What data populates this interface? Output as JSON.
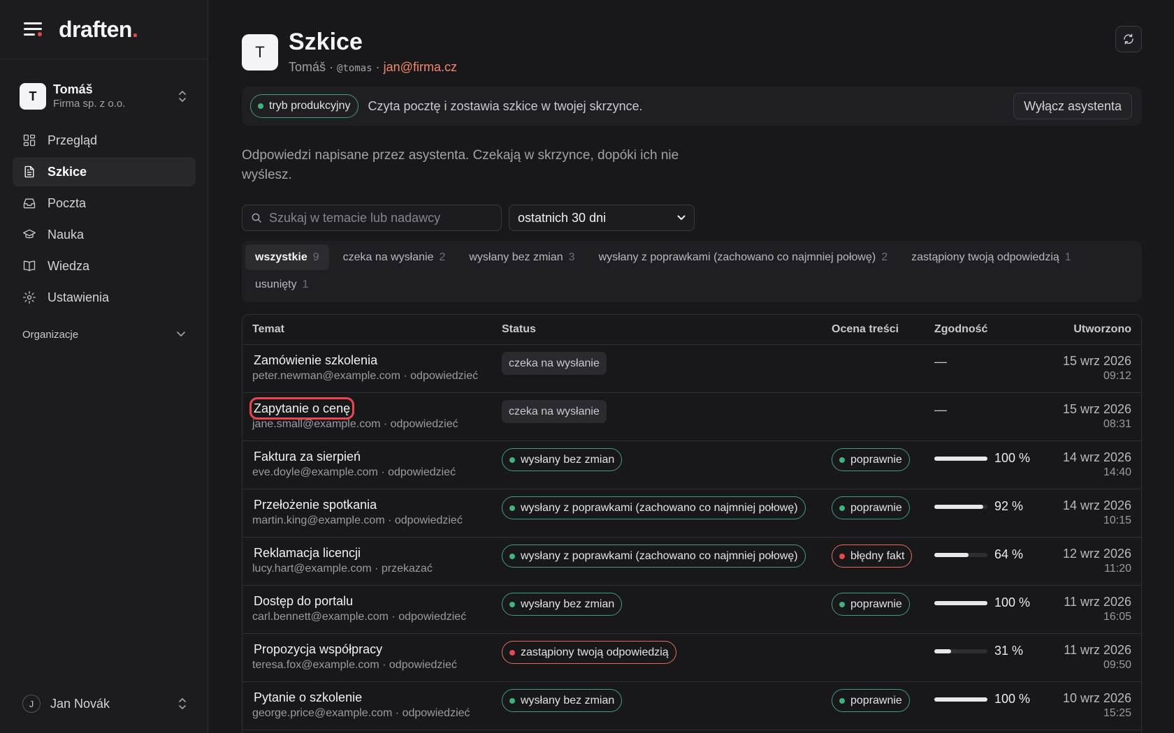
{
  "brand": {
    "name": "draften",
    "dot": "."
  },
  "account": {
    "initial": "T",
    "name": "Tomáš",
    "org": "Firma sp. z o.o."
  },
  "nav": [
    {
      "label": "Przegląd",
      "icon": "grid-icon",
      "active": false
    },
    {
      "label": "Szkice",
      "icon": "document-icon",
      "active": true
    },
    {
      "label": "Poczta",
      "icon": "inbox-icon",
      "active": false
    },
    {
      "label": "Nauka",
      "icon": "graduation-cap-icon",
      "active": false
    },
    {
      "label": "Wiedza",
      "icon": "book-icon",
      "active": false
    },
    {
      "label": "Ustawienia",
      "icon": "gear-icon",
      "active": false
    }
  ],
  "org_section": {
    "label": "Organizacje"
  },
  "user": {
    "initial": "J",
    "name": "Jan Novák"
  },
  "page": {
    "initial": "T",
    "title": "Szkice",
    "owner": "Tomáš",
    "handle": "@tomas",
    "email": "jan@firma.cz",
    "sep": "·"
  },
  "banner": {
    "mode": "tryb produkcyjny",
    "text": "Czyta pocztę i zostawia szkice w twojej skrzynce.",
    "button": "Wyłącz asystenta"
  },
  "description": "Odpowiedzi napisane przez asystenta. Czekają w skrzynce, dopóki ich nie wyślesz.",
  "search": {
    "placeholder": "Szukaj w temacie lub nadawcy",
    "value": ""
  },
  "range": {
    "selected": "ostatnich 30 dni"
  },
  "filters": [
    {
      "label": "wszystkie",
      "count": "9",
      "active": true
    },
    {
      "label": "czeka na wysłanie",
      "count": "2",
      "active": false
    },
    {
      "label": "wysłany bez zmian",
      "count": "3",
      "active": false
    },
    {
      "label": "wysłany z poprawkami (zachowano co najmniej połowę)",
      "count": "2",
      "active": false
    },
    {
      "label": "zastąpiony twoją odpowiedzią",
      "count": "1",
      "active": false
    },
    {
      "label": "usunięty",
      "count": "1",
      "active": false
    }
  ],
  "table": {
    "headers": {
      "subject": "Temat",
      "status": "Status",
      "score": "Ocena treści",
      "conformity": "Zgodność",
      "created": "Utworzono"
    },
    "rows": [
      {
        "subject": "Zamówienie szkolenia",
        "from": "peter.newman@example.com",
        "action": "odpowiedzieć",
        "status": "czeka na wysłanie",
        "status_kind": "plain",
        "score": "",
        "score_kind": "",
        "conformity": null,
        "conformity_text": "—",
        "date": "15 wrz 2026",
        "time": "09:12",
        "focused": false
      },
      {
        "subject": "Zapytanie o cenę",
        "from": "jane.small@example.com",
        "action": "odpowiedzieć",
        "status": "czeka na wysłanie",
        "status_kind": "plain",
        "score": "",
        "score_kind": "",
        "conformity": null,
        "conformity_text": "—",
        "date": "15 wrz 2026",
        "time": "08:31",
        "focused": true
      },
      {
        "subject": "Faktura za sierpień",
        "from": "eve.doyle@example.com",
        "action": "odpowiedzieć",
        "status": "wysłany bez zmian",
        "status_kind": "green",
        "score": "poprawnie",
        "score_kind": "green",
        "conformity": 100,
        "conformity_text": "100 %",
        "date": "14 wrz 2026",
        "time": "14:40",
        "focused": false
      },
      {
        "subject": "Przełożenie spotkania",
        "from": "martin.king@example.com",
        "action": "odpowiedzieć",
        "status": "wysłany z poprawkami (zachowano co najmniej połowę)",
        "status_kind": "green",
        "score": "poprawnie",
        "score_kind": "green",
        "conformity": 92,
        "conformity_text": "92 %",
        "date": "14 wrz 2026",
        "time": "10:15",
        "focused": false
      },
      {
        "subject": "Reklamacja licencji",
        "from": "lucy.hart@example.com",
        "action": "przekazać",
        "status": "wysłany z poprawkami (zachowano co najmniej połowę)",
        "status_kind": "green",
        "score": "błędny fakt",
        "score_kind": "red",
        "conformity": 64,
        "conformity_text": "64 %",
        "date": "12 wrz 2026",
        "time": "11:20",
        "focused": false
      },
      {
        "subject": "Dostęp do portalu",
        "from": "carl.bennett@example.com",
        "action": "odpowiedzieć",
        "status": "wysłany bez zmian",
        "status_kind": "green",
        "score": "poprawnie",
        "score_kind": "green",
        "conformity": 100,
        "conformity_text": "100 %",
        "date": "11 wrz 2026",
        "time": "16:05",
        "focused": false
      },
      {
        "subject": "Propozycja współpracy",
        "from": "teresa.fox@example.com",
        "action": "odpowiedzieć",
        "status": "zastąpiony twoją odpowiedzią",
        "status_kind": "red",
        "score": "",
        "score_kind": "",
        "conformity": 31,
        "conformity_text": "31 %",
        "date": "11 wrz 2026",
        "time": "09:50",
        "focused": false
      },
      {
        "subject": "Pytanie o szkolenie",
        "from": "george.price@example.com",
        "action": "odpowiedzieć",
        "status": "wysłany bez zmian",
        "status_kind": "green",
        "score": "poprawnie",
        "score_kind": "green",
        "conformity": 100,
        "conformity_text": "100 %",
        "date": "10 wrz 2026",
        "time": "15:25",
        "focused": false
      }
    ]
  }
}
